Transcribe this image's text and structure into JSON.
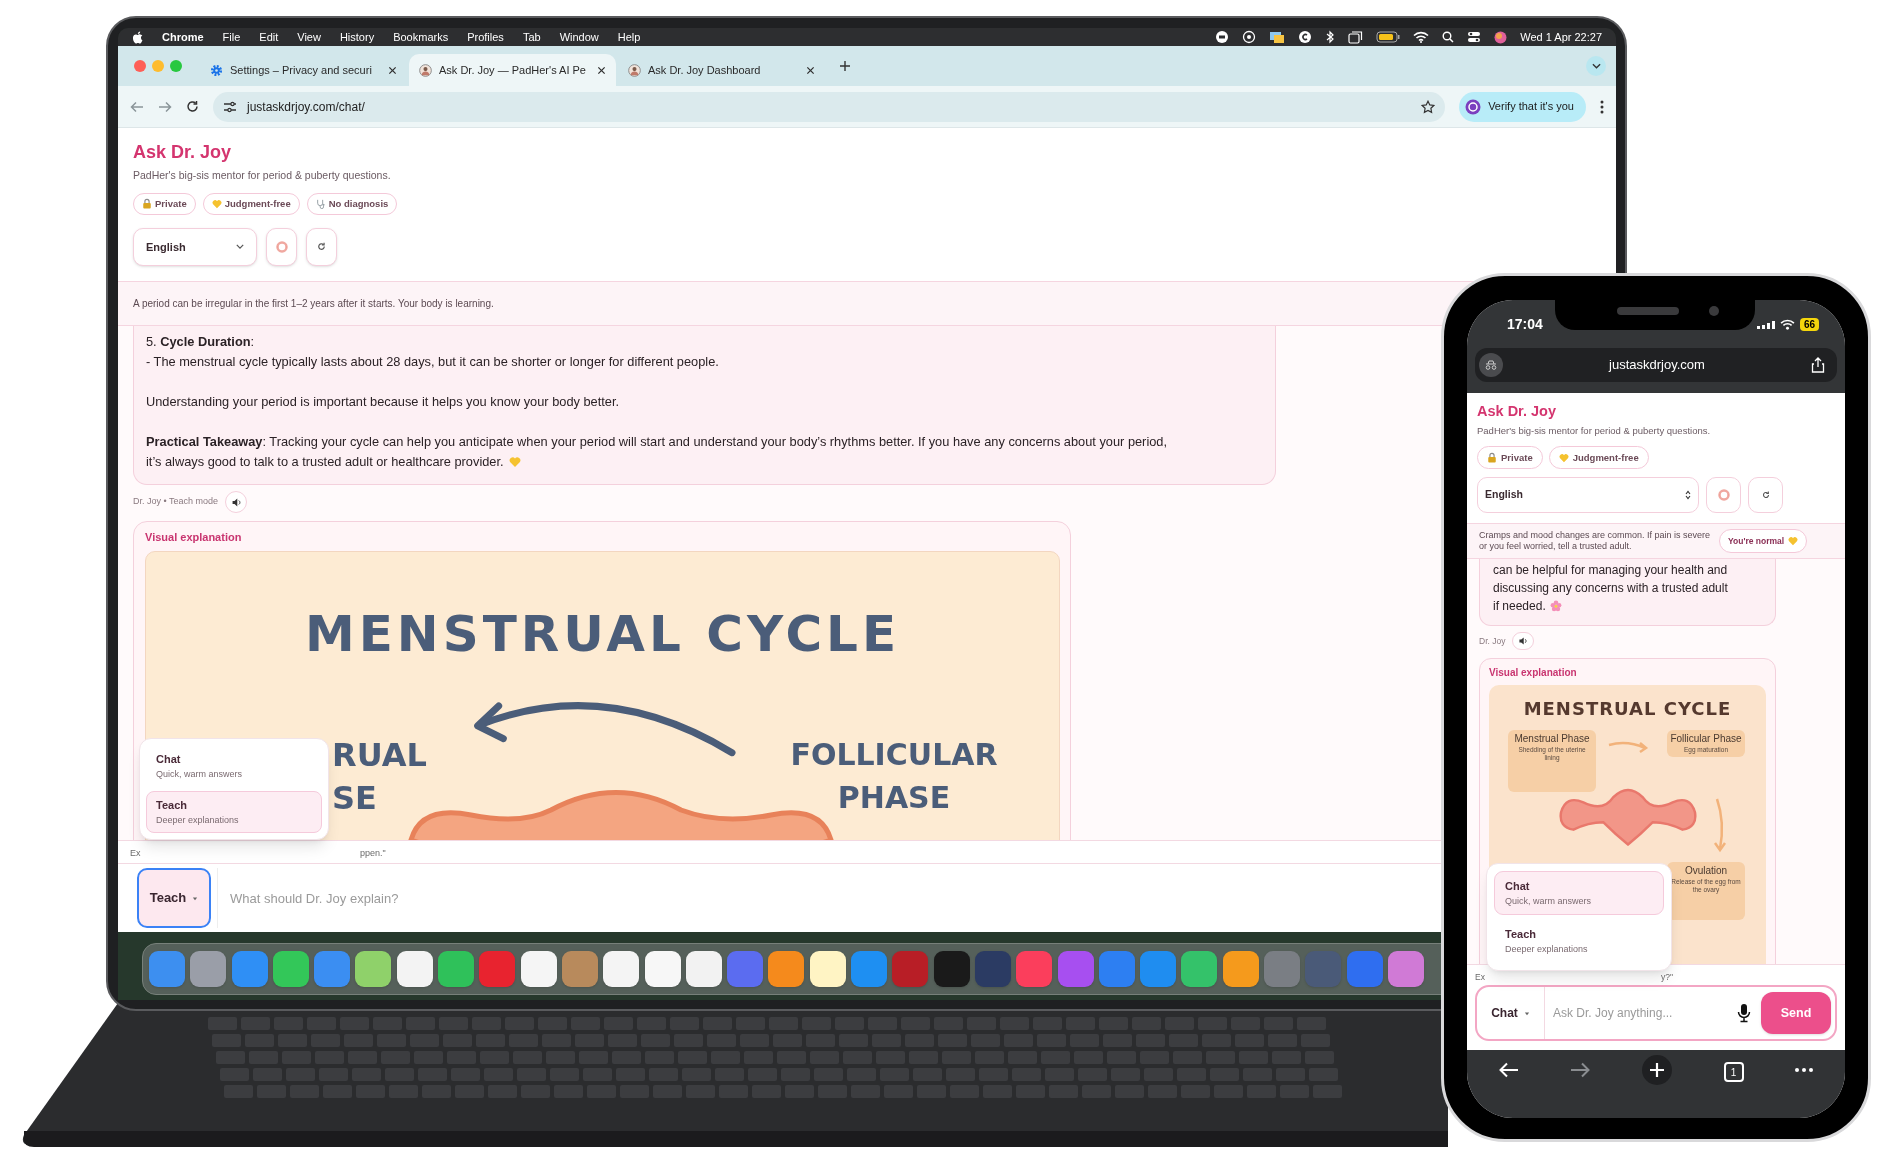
{
  "laptop": {
    "menu_bar": {
      "app": "Chrome",
      "menus": [
        "File",
        "Edit",
        "View",
        "History",
        "Bookmarks",
        "Profiles",
        "Tab",
        "Window",
        "Help"
      ],
      "clock": "Wed 1 Apr  22:27"
    },
    "browser": {
      "tabs": [
        {
          "title": "Settings – Privacy and securi",
          "kind": "settings",
          "selected": false
        },
        {
          "title": "Ask Dr. Joy — PadHer's AI Pe",
          "kind": "site",
          "selected": true
        },
        {
          "title": "Ask Dr. Joy Dashboard",
          "kind": "site",
          "selected": false
        }
      ],
      "url": "justaskdrjoy.com/chat/",
      "profile_button": "Verify that it's you"
    },
    "page": {
      "title": "Ask Dr. Joy",
      "subtitle": "PadHer's big-sis mentor for period & puberty questions.",
      "chips": [
        {
          "label": "Private",
          "kind": "lock"
        },
        {
          "label": "Judgment-free",
          "kind": "heart"
        },
        {
          "label": "No diagnosis",
          "kind": "stethoscope"
        }
      ],
      "language": "English",
      "banner": "A period can be irregular in the first 1–2 years after it starts. Your body is learning.",
      "message": [
        [
          "5. **Cycle Duration**:",
          "- The menstrual cycle typically lasts about 28 days, but it can be shorter or longer for different people."
        ],
        [
          "Understanding your period is important because it helps you know your body better."
        ],
        [
          "**Practical Takeaway**: Tracking your cycle can help you anticipate when your period will start and understand your body’s rhythms better. If you have any concerns about your period,",
          "it’s always good to talk to a trusted adult or healthcare provider."
        ]
      ],
      "meta": "Dr. Joy • Teach mode",
      "visual": {
        "heading": "Visual explanation",
        "diagram": {
          "title": "MENSTRUAL CYCLE",
          "left_label": [
            "RUAL",
            "SE"
          ],
          "right_label": [
            "FOLLICULAR",
            "PHASE"
          ]
        }
      },
      "hint": {
        "start": "Ex",
        "end": "ppen.\""
      },
      "mode_menu": [
        {
          "label": "Chat",
          "description": "Quick, warm answers",
          "selected": false
        },
        {
          "label": "Teach",
          "description": "Deeper explanations",
          "selected": true
        }
      ],
      "composer": {
        "mode": "Teach",
        "placeholder": "What should Dr. Joy explain?"
      }
    }
  },
  "phone": {
    "status": {
      "time": "17:04",
      "battery": "66"
    },
    "url": "justaskdrjoy.com",
    "page": {
      "title": "Ask Dr. Joy",
      "subtitle": "PadHer's big-sis mentor for period & puberty questions.",
      "chips": [
        {
          "label": "Private",
          "kind": "lock"
        },
        {
          "label": "Judgment-free",
          "kind": "heart"
        }
      ],
      "language": "English",
      "banner": "Cramps and mood changes are common. If pain is severe or you feel worried, tell a trusted adult.",
      "banner_button": "You're normal",
      "message": [
        "can be helpful for managing your health and",
        "discussing any concerns with a trusted adult",
        "if needed."
      ],
      "meta": "Dr. Joy",
      "visual": {
        "heading": "Visual explanation",
        "diagram": {
          "title": "MENSTRUAL CYCLE",
          "phases": [
            {
              "name": "Menstrual Phase",
              "detail": "Shedding of the uterine lining"
            },
            {
              "name": "Follicular Phase",
              "detail": "Egg maturation"
            },
            {
              "name": "Ovulation",
              "detail": "Release of the egg from the ovary"
            }
          ]
        }
      },
      "hint": {
        "start": "Ex",
        "end": "y?\""
      },
      "mode_menu": [
        {
          "label": "Chat",
          "description": "Quick, warm answers",
          "selected": true
        },
        {
          "label": "Teach",
          "description": "Deeper explanations",
          "selected": false
        }
      ],
      "composer": {
        "mode": "Chat",
        "placeholder": "Ask Dr. Joy anything...",
        "send": "Send"
      }
    },
    "tab_count": "1"
  }
}
